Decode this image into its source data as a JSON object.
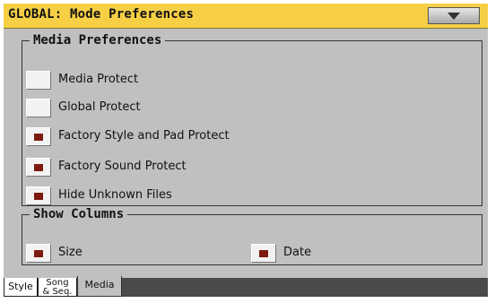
{
  "window": {
    "title": "GLOBAL: Mode Preferences",
    "menu_icon": "triangle-down-icon"
  },
  "media_preferences": {
    "legend": "Media Preferences",
    "items": [
      {
        "label": "Media Protect",
        "checked": false
      },
      {
        "label": "Global Protect",
        "checked": false
      },
      {
        "label": "Factory Style and Pad Protect",
        "checked": true
      },
      {
        "label": "Factory Sound Protect",
        "checked": true
      },
      {
        "label": "Hide Unknown Files",
        "checked": true
      }
    ]
  },
  "show_columns": {
    "legend": "Show Columns",
    "items": [
      {
        "label": "Size",
        "checked": true
      },
      {
        "label": "Date",
        "checked": true
      }
    ]
  },
  "tabs": [
    {
      "line1": "Style",
      "line2": "",
      "selected": false
    },
    {
      "line1": "Song",
      "line2": "& Seq.",
      "selected": false
    },
    {
      "line1": "Media",
      "line2": "",
      "selected": true
    }
  ],
  "colors": {
    "title_bar": "#f6cf45",
    "panel": "#c0c0c0",
    "check_mark": "#7d1a10"
  }
}
